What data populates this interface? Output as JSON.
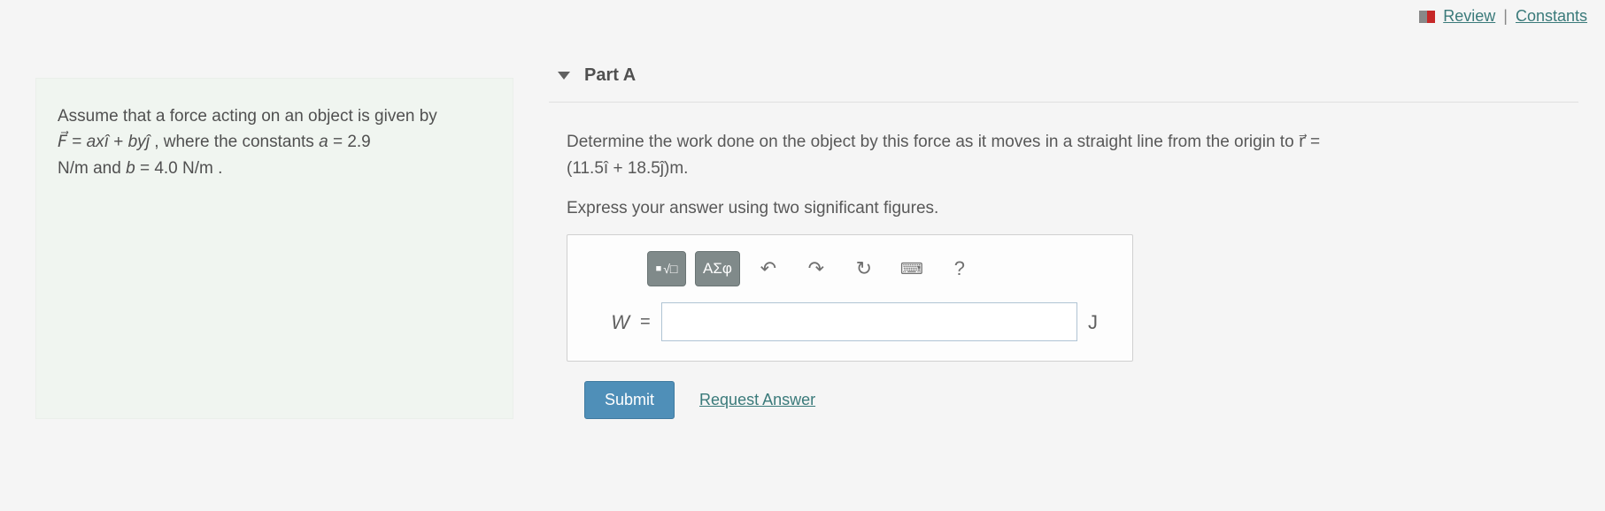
{
  "top_links": {
    "review": "Review",
    "constants": "Constants"
  },
  "problem": {
    "line1": "Assume that a force acting on an object is given by",
    "formula_html": "F⃗ = axî + byĵ , where the constants a = 2.9",
    "line3": "N/m and b = 4.0 N/m ."
  },
  "part": {
    "label": "Part A",
    "question_line1": "Determine the work done on the object by this force as it moves in a straight line from the origin to r⃗ =",
    "question_line2": "(11.5î + 18.5ĵ)m.",
    "instruction": "Express your answer using two significant figures."
  },
  "answer": {
    "variable": "W",
    "equals": "=",
    "unit": "J",
    "value": ""
  },
  "toolbar": {
    "templates_label": "x^a √□",
    "greek_label": "ΑΣφ",
    "undo": "↶",
    "redo": "↷",
    "reset": "↻",
    "keyboard": "⌨",
    "help": "?"
  },
  "actions": {
    "submit": "Submit",
    "request": "Request Answer"
  }
}
